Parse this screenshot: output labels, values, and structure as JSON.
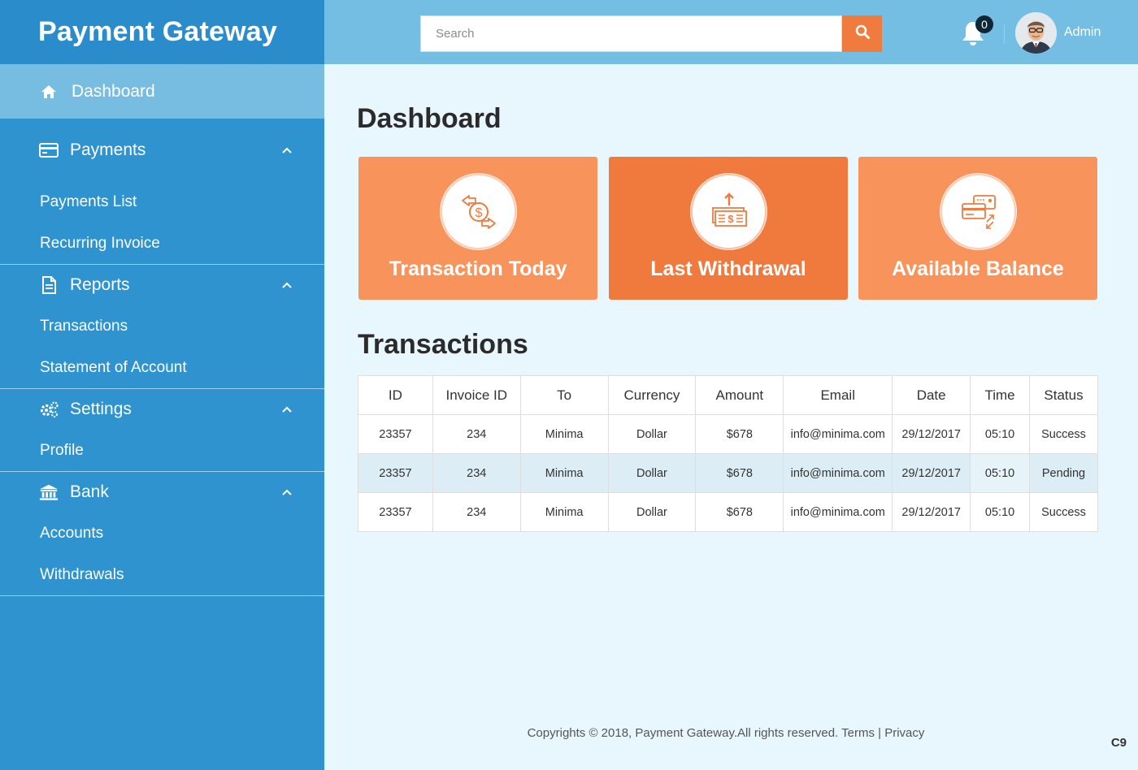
{
  "app": {
    "brand": "Payment Gateway"
  },
  "sidebar": {
    "dashboard": {
      "label": "Dashboard",
      "icon": "home-icon"
    },
    "sections": [
      {
        "label": "Payments",
        "icon": "credit-card-icon",
        "items": [
          "Payments List",
          "Recurring Invoice"
        ]
      },
      {
        "label": "Reports",
        "icon": "document-icon",
        "items": [
          "Transactions",
          "Statement of Account"
        ]
      },
      {
        "label": "Settings",
        "icon": "gears-icon",
        "items": [
          "Profile"
        ]
      },
      {
        "label": "Bank",
        "icon": "bank-icon",
        "items": [
          "Accounts",
          "Withdrawals"
        ]
      }
    ]
  },
  "topbar": {
    "search_placeholder": "Search",
    "search_value": "",
    "notifications_count": "0",
    "user_name": "Admin"
  },
  "main": {
    "title": "Dashboard",
    "cards": [
      {
        "label": "Transaction Today",
        "icon": "exchange-dollar-icon"
      },
      {
        "label": "Last Withdrawal",
        "icon": "withdraw-cash-icon"
      },
      {
        "label": "Available Balance",
        "icon": "cards-transfer-icon"
      }
    ],
    "transactions_title": "Transactions",
    "table": {
      "headers": [
        "ID",
        "Invoice ID",
        "To",
        "Currency",
        "Amount",
        "Email",
        "Date",
        "Time",
        "Status"
      ],
      "rows": [
        [
          "23357",
          "234",
          "Minima",
          "Dollar",
          "$678",
          "info@minima.com",
          "29/12/2017",
          "05:10",
          "Success"
        ],
        [
          "23357",
          "234",
          "Minima",
          "Dollar",
          "$678",
          "info@minima.com",
          "29/12/2017",
          "05:10",
          "Pending"
        ],
        [
          "23357",
          "234",
          "Minima",
          "Dollar",
          "$678",
          "info@minima.com",
          "29/12/2017",
          "05:10",
          "Success"
        ]
      ]
    }
  },
  "footer": {
    "copyright": "Copyrights © 2018, Payment Gateway.All rights reserved.",
    "terms": "Terms",
    "separator": "|",
    "privacy": "Privacy"
  },
  "corner_label": "C9",
  "colors": {
    "sidebar": "#2e93cf",
    "sidebar_active": "#77bde2",
    "topbar": "#74bde3",
    "accent": "#f07b3f",
    "card": "#f8935c",
    "card_active": "#f07a3e",
    "page_bg": "#e8f6fd"
  }
}
